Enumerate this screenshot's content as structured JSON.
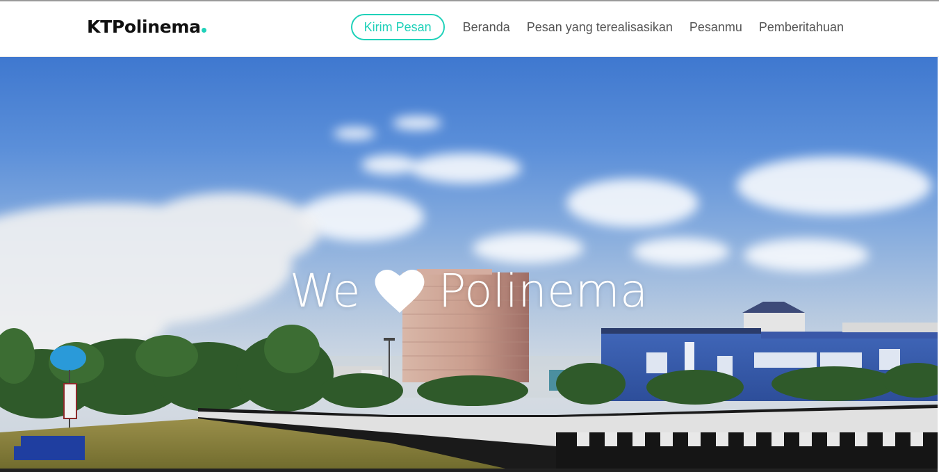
{
  "brand": {
    "name": "KTPolinema",
    "accent": "#1fd1b9"
  },
  "nav": {
    "primary_button": "Kirim Pesan",
    "links": [
      "Beranda",
      "Pesan yang terealisasikan",
      "Pesanmu",
      "Pemberitahuan"
    ]
  },
  "hero": {
    "title_before": "We",
    "icon": "heart-icon",
    "title_after": "Polinema"
  },
  "colors": {
    "accent": "#1fd1b9",
    "nav_text": "#555555",
    "brand_text": "#111111"
  }
}
